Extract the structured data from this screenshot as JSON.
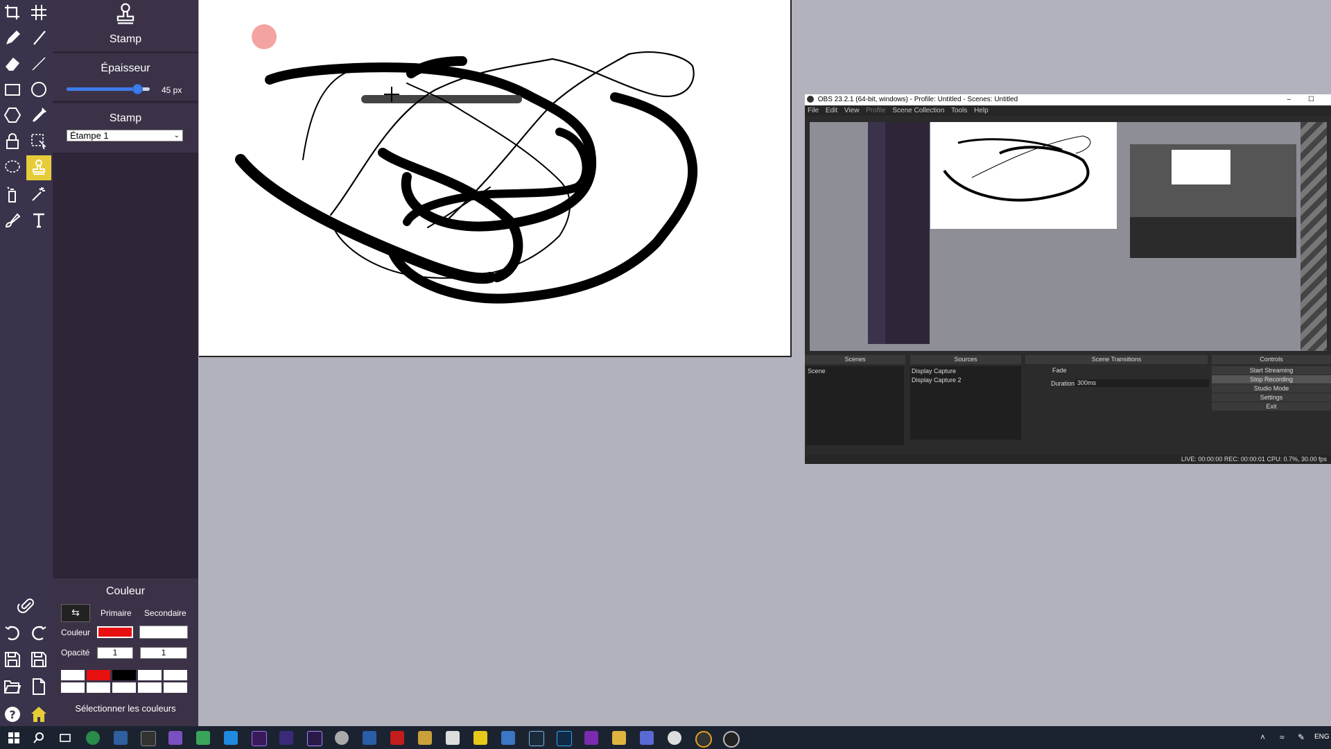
{
  "toolbar": {
    "tools": [
      "crop-icon",
      "grid-icon",
      "pencil-icon",
      "brush-icon",
      "eraser-icon",
      "line-icon",
      "rectangle-icon",
      "ellipse-icon",
      "polygon-icon",
      "eyedropper-icon",
      "lock-icon",
      "selection-icon",
      "lasso-icon",
      "stamp-icon",
      "spray-icon",
      "magic-wand-icon",
      "fill-icon",
      "text-icon"
    ],
    "active_tool": "stamp-icon",
    "bottom": [
      "pin-icon",
      "undo-icon",
      "redo-icon",
      "save-as-icon",
      "save-icon",
      "open-icon",
      "new-file-icon",
      "help-icon",
      "home-icon"
    ]
  },
  "panel": {
    "tool_name": "Stamp",
    "thickness_label": "Épaisseur",
    "thickness_value": "45 px",
    "thickness_fraction": 0.85,
    "stamp_label": "Stamp",
    "stamp_select": "Étampe 1",
    "color_title": "Couleur",
    "primary_label": "Primaire",
    "secondary_label": "Secondaire",
    "color_row_label": "Couleur",
    "opacity_row_label": "Opacité",
    "primary_opacity": "1",
    "secondary_opacity": "1",
    "primary_color": "#e81010",
    "secondary_color": "#ffffff",
    "select_colors_label": "Sélectionner les couleurs"
  },
  "obs": {
    "title": "OBS 23.2.1 (64-bit, windows) - Profile: Untitled - Scenes: Untitled",
    "menu": [
      "File",
      "Edit",
      "View",
      "Profile",
      "Scene Collection",
      "Tools",
      "Help"
    ],
    "scenes_header": "Scenes",
    "sources_header": "Sources",
    "transitions_header": "Scene Transitions",
    "controls_header": "Controls",
    "scene_item": "Scene",
    "source_1": "Display Capture",
    "source_2": "Display Capture 2",
    "transition": "Fade",
    "duration_label": "Duration",
    "duration_value": "300ms",
    "controls": [
      "Start Streaming",
      "Stop Recording",
      "Studio Mode",
      "Settings",
      "Exit"
    ],
    "status": "LIVE: 00:00:00   REC: 00:00:01   CPU: 0.7%, 30.00 fps"
  },
  "taskbar": {
    "language": "ENG"
  }
}
